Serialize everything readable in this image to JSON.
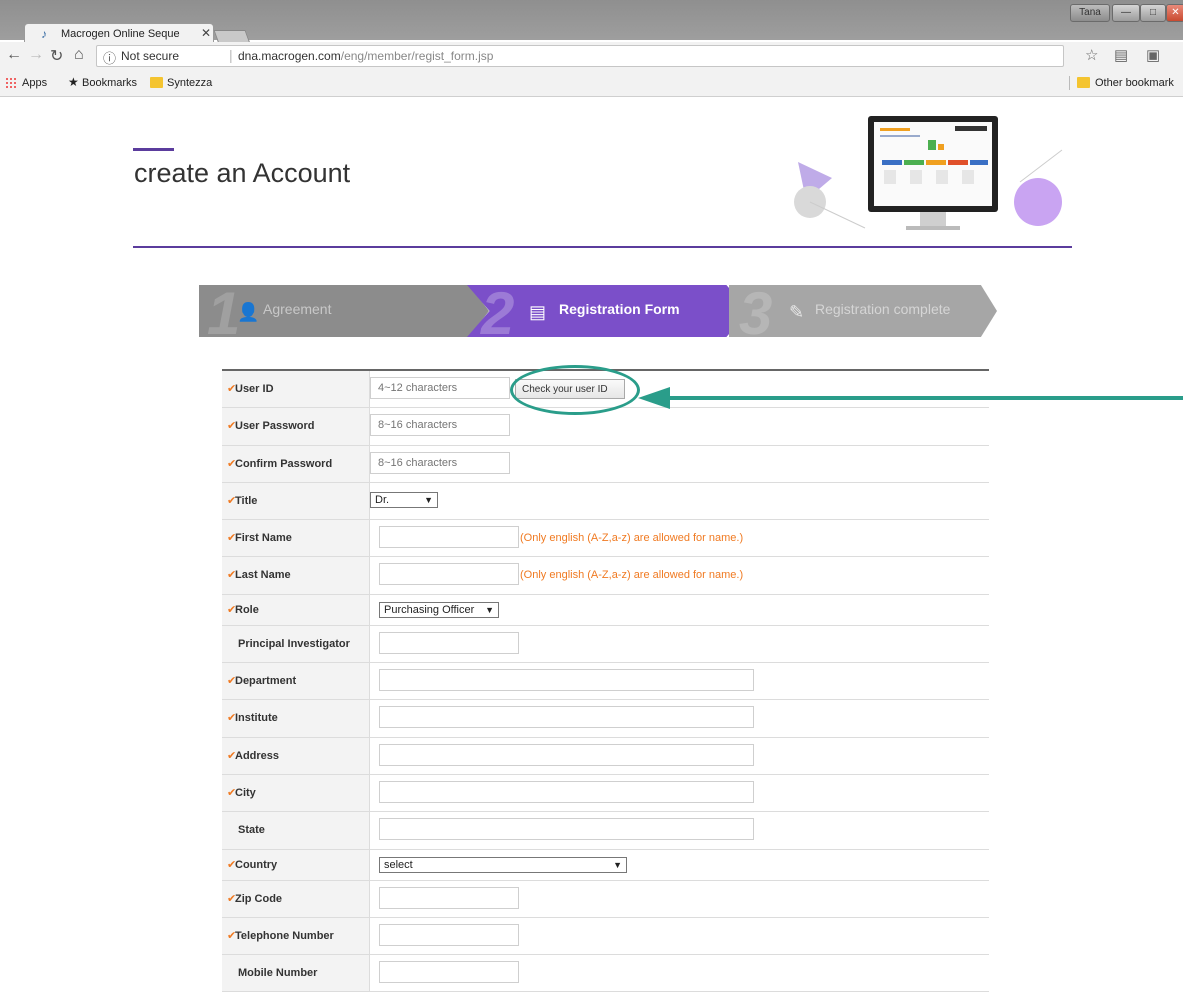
{
  "browser": {
    "tab_title": "Macrogen Online Seque",
    "tab_close": "✕",
    "user_button": "Tana",
    "security_label": "Not secure",
    "url_host": "dna.macrogen.com",
    "url_path": "/eng/member/regist_form.jsp",
    "bookmarks": {
      "apps": "Apps",
      "bookmarks": "Bookmarks",
      "syntezza": "Syntezza",
      "other": "Other bookmark"
    }
  },
  "page": {
    "title": "create an Account",
    "accent_color": "#5b3c9d"
  },
  "steps": [
    {
      "num": "1",
      "label": "Agreement",
      "state": "done"
    },
    {
      "num": "2",
      "label": "Registration Form",
      "state": "active"
    },
    {
      "num": "3",
      "label": "Registration complete",
      "state": "pending"
    }
  ],
  "form": {
    "user_id": {
      "label": "User ID",
      "placeholder": "4~12 characters",
      "button": "Check your user ID"
    },
    "password": {
      "label": "User Password",
      "placeholder": "8~16 characters"
    },
    "confirm": {
      "label": "Confirm Password",
      "placeholder": "8~16 characters"
    },
    "title": {
      "label": "Title",
      "value": "Dr."
    },
    "first_name": {
      "label": "First Name",
      "hint": "(Only english (A-Z,a-z) are allowed for name.)"
    },
    "last_name": {
      "label": "Last Name",
      "hint": "(Only english (A-Z,a-z) are allowed for name.)"
    },
    "role": {
      "label": "Role",
      "value": "Purchasing Officer"
    },
    "pi": {
      "label": "Principal Investigator"
    },
    "department": {
      "label": "Department"
    },
    "institute": {
      "label": "Institute"
    },
    "address": {
      "label": "Address"
    },
    "city": {
      "label": "City"
    },
    "state": {
      "label": "State"
    },
    "country": {
      "label": "Country",
      "value": "select"
    },
    "zip": {
      "label": "Zip Code"
    },
    "telephone": {
      "label": "Telephone Number"
    },
    "mobile": {
      "label": "Mobile Number"
    }
  },
  "annotation_color": "#2a9d8a"
}
